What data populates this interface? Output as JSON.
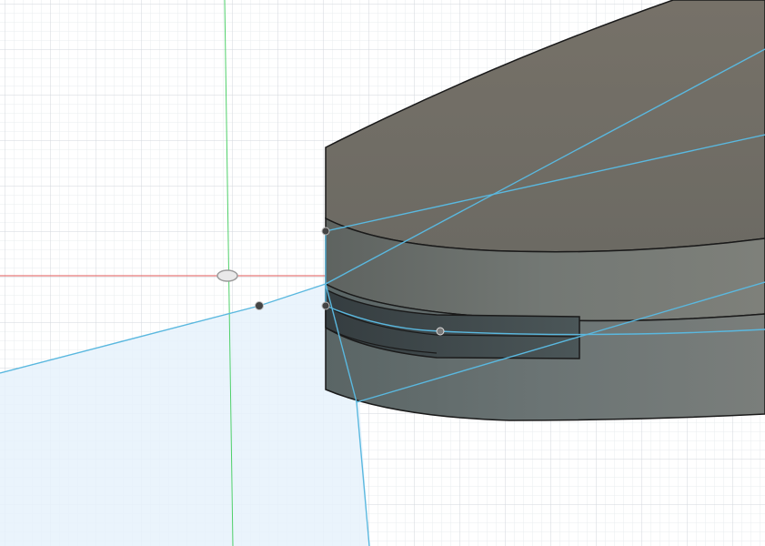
{
  "app": {
    "view": "3d-viewport",
    "icons": [
      "origin-icon",
      "sketch-point-icon"
    ]
  },
  "colors": {
    "background": "#ffffff",
    "grid_minor": "#e9ecef",
    "grid_major": "#d3d7dc",
    "x_axis": "#e05a5a",
    "y_axis": "#4fd06a",
    "sketch_line": "#5ab8df",
    "sketch_profile_fill": "#e6f2fb",
    "body_face": "#6e6b64",
    "body_face_lower": "#606b6b",
    "slot_interior": "#3f4749",
    "edge": "#1a1a1a",
    "point": "#444444"
  }
}
